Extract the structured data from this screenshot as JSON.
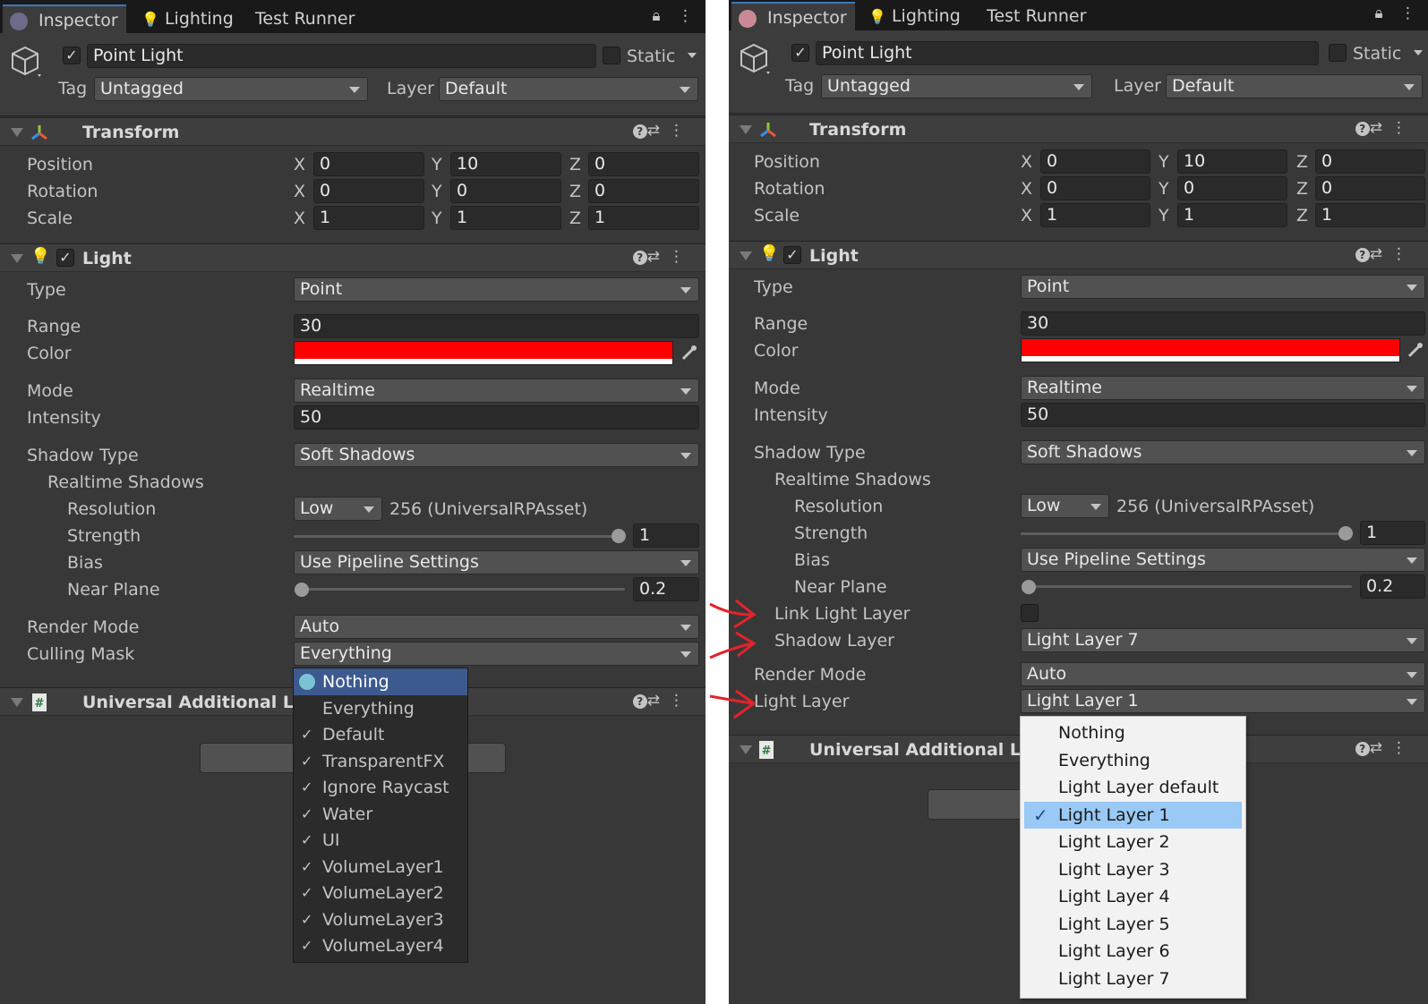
{
  "colors": {
    "panel_bg": "#383838",
    "tabbar_bg": "#191919",
    "field_bg": "#2a2a2a",
    "dropdown_bg": "#515151",
    "text": "#c4c4c4",
    "selection_dark": "#3d5a8f",
    "selection_light": "#99c9f4",
    "light_color": "#ff0000",
    "annotation_arrow": "#e4232a"
  },
  "tabs": {
    "inspector": "Inspector",
    "lighting": "Lighting",
    "test_runner": "Test Runner"
  },
  "object": {
    "name": "Point Light",
    "static_label": "Static",
    "tag_label": "Tag",
    "tag_value": "Untagged",
    "layer_label": "Layer",
    "layer_value": "Default"
  },
  "transform": {
    "title": "Transform",
    "position_label": "Position",
    "rotation_label": "Rotation",
    "scale_label": "Scale",
    "x": "X",
    "y": "Y",
    "z": "Z",
    "position": [
      "0",
      "10",
      "0"
    ],
    "rotation": [
      "0",
      "0",
      "0"
    ],
    "scale": [
      "1",
      "1",
      "1"
    ]
  },
  "light": {
    "title": "Light",
    "type_label": "Type",
    "type_value": "Point",
    "range_label": "Range",
    "range_value": "30",
    "color_label": "Color",
    "mode_label": "Mode",
    "mode_value": "Realtime",
    "intensity_label": "Intensity",
    "intensity_value": "50",
    "shadow_type_label": "Shadow Type",
    "shadow_type_value": "Soft Shadows",
    "realtime_shadows_label": "Realtime Shadows",
    "resolution_label": "Resolution",
    "resolution_value": "Low",
    "resolution_note": "256 (UniversalRPAsset)",
    "strength_label": "Strength",
    "strength_value": "1",
    "bias_label": "Bias",
    "bias_value": "Use Pipeline Settings",
    "near_plane_label": "Near Plane",
    "near_plane_value": "0.2",
    "render_mode_label": "Render Mode",
    "render_mode_value": "Auto",
    "culling_mask_label": "Culling Mask",
    "culling_mask_value": "Everything",
    "link_light_layer_label": "Link Light Layer",
    "shadow_layer_label": "Shadow Layer",
    "shadow_layer_value": "Light Layer 7",
    "light_layer_label": "Light Layer",
    "light_layer_value": "Light Layer 1"
  },
  "universal": {
    "title": "Universal Additional Light"
  },
  "left_menu": {
    "items": [
      {
        "label": "Nothing",
        "checked": false,
        "selected": true
      },
      {
        "label": "Everything",
        "checked": false,
        "selected": false
      },
      {
        "label": "Default",
        "checked": true,
        "selected": false
      },
      {
        "label": "TransparentFX",
        "checked": true,
        "selected": false
      },
      {
        "label": "Ignore Raycast",
        "checked": true,
        "selected": false
      },
      {
        "label": "Water",
        "checked": true,
        "selected": false
      },
      {
        "label": "UI",
        "checked": true,
        "selected": false
      },
      {
        "label": "VolumeLayer1",
        "checked": true,
        "selected": false
      },
      {
        "label": "VolumeLayer2",
        "checked": true,
        "selected": false
      },
      {
        "label": "VolumeLayer3",
        "checked": true,
        "selected": false
      },
      {
        "label": "VolumeLayer4",
        "checked": true,
        "selected": false
      }
    ]
  },
  "right_menu": {
    "items": [
      {
        "label": "Nothing",
        "checked": false,
        "selected": false
      },
      {
        "label": "Everything",
        "checked": false,
        "selected": false
      },
      {
        "label": "Light Layer default",
        "checked": false,
        "selected": false
      },
      {
        "label": "Light Layer 1",
        "checked": true,
        "selected": true
      },
      {
        "label": "Light Layer 2",
        "checked": false,
        "selected": false
      },
      {
        "label": "Light Layer 3",
        "checked": false,
        "selected": false
      },
      {
        "label": "Light Layer 4",
        "checked": false,
        "selected": false
      },
      {
        "label": "Light Layer 5",
        "checked": false,
        "selected": false
      },
      {
        "label": "Light Layer 6",
        "checked": false,
        "selected": false
      },
      {
        "label": "Light Layer 7",
        "checked": false,
        "selected": false
      }
    ]
  },
  "icons": {
    "lock": "lock-icon",
    "kebab": "kebab-menu-icon",
    "help": "help-icon",
    "settings": "preset-settings-icon",
    "check": "✓",
    "eyedropper": "eyedropper-icon"
  }
}
